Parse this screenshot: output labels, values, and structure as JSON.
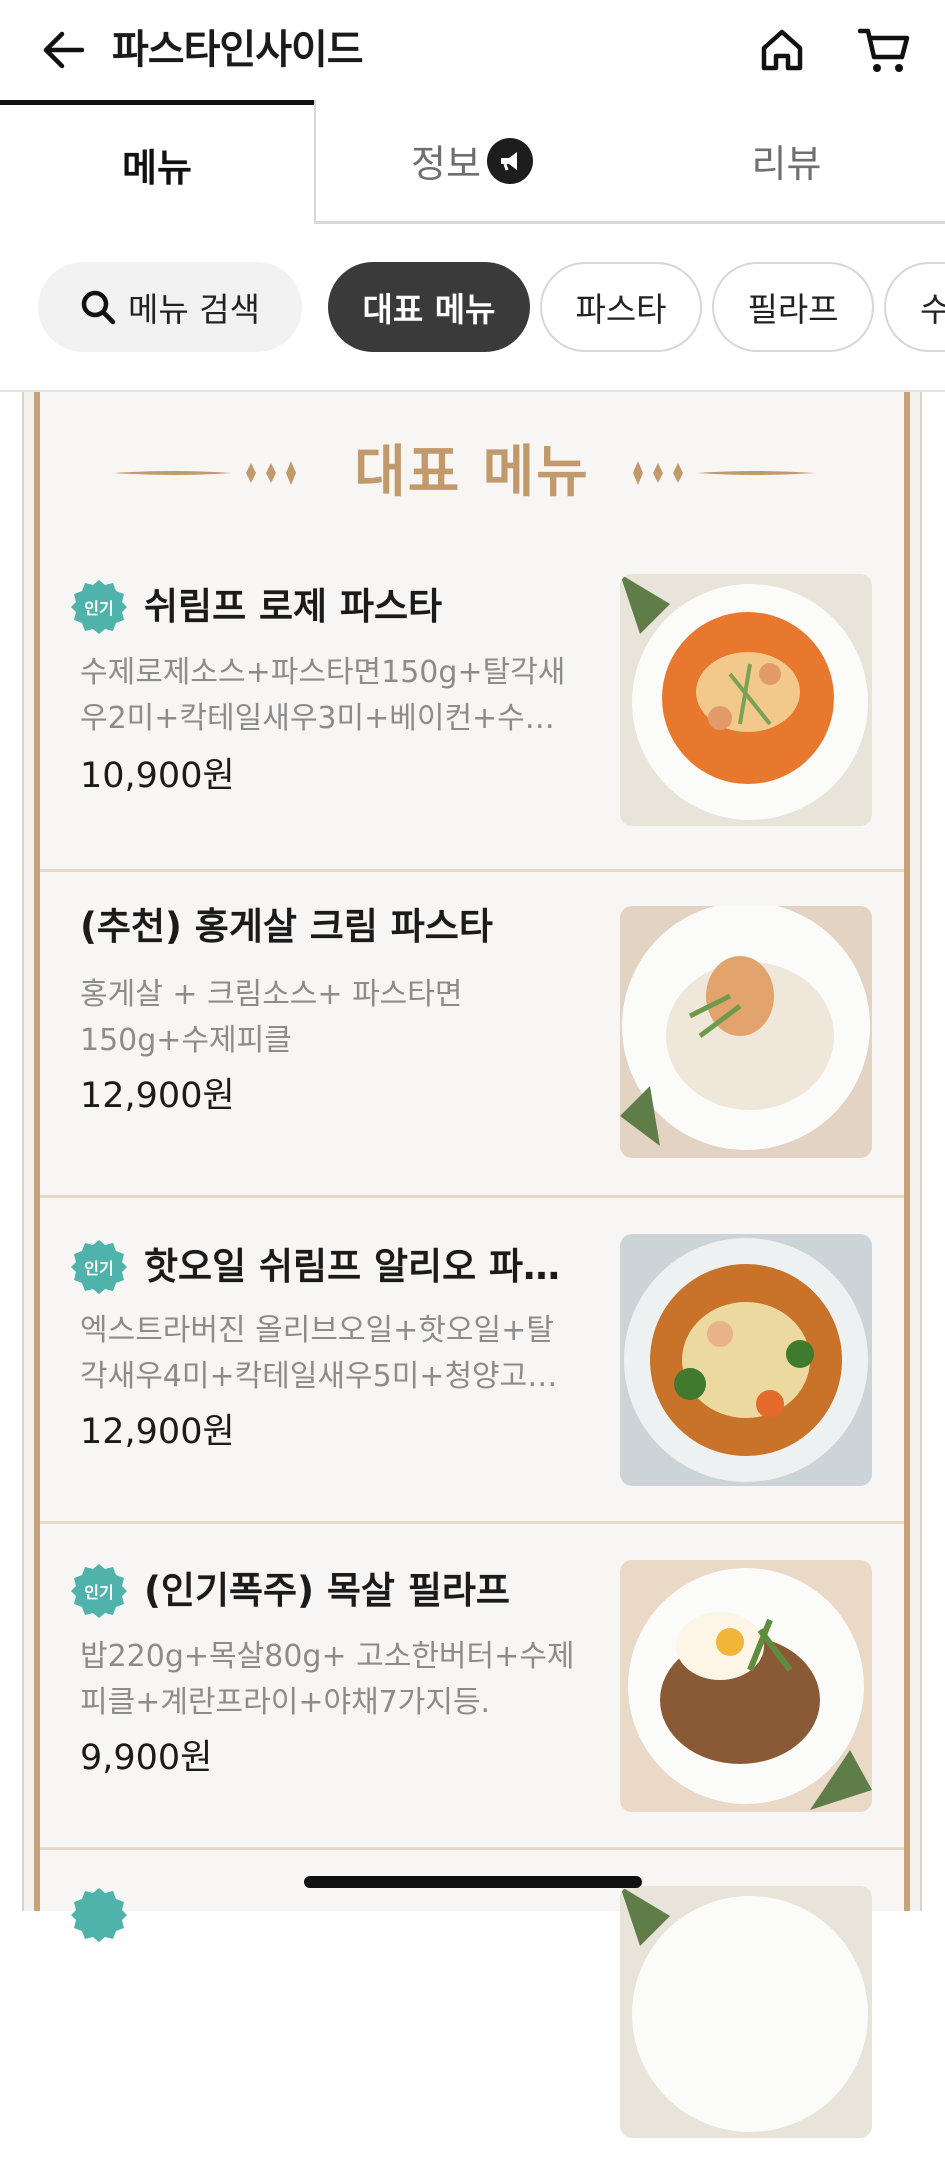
{
  "header": {
    "title": "파스타인사이드",
    "back_icon": "arrow-left-icon",
    "home_icon": "home-icon",
    "cart_icon": "cart-icon"
  },
  "tabs": [
    {
      "label": "메뉴",
      "active": true
    },
    {
      "label": "정보",
      "icon": "megaphone-icon"
    },
    {
      "label": "리뷰"
    }
  ],
  "chips": {
    "search_label": "메뉴 검색",
    "categories": [
      "대표 메뉴",
      "파스타",
      "필라프",
      "수"
    ]
  },
  "section": {
    "title": "대표 메뉴"
  },
  "items": [
    {
      "badge": "인기",
      "name": "쉬림프 로제 파스타",
      "description": "수제로제소스+파스타면150g+탈각새우2미+칵테일새우3미+베이컨+수…",
      "price": "10,900원"
    },
    {
      "badge": "",
      "name": "(추천) 홍게살 크림 파스타",
      "description": "홍게살 + 크림소스+ 파스타면150g+수제피클",
      "price": "12,900원"
    },
    {
      "badge": "인기",
      "name": "핫오일 쉬림프 알리오 파…",
      "description": "엑스트라버진 올리브오일+핫오일+탈각새우4미+칵테일새우5미+청양고…",
      "price": "12,900원"
    },
    {
      "badge": "인기",
      "name": "(인기폭주) 목살 필라프",
      "description": "밥220g+목살80g+ 고소한버터+수제피클+계란프라이+야채7가지등.",
      "price": "9,900원"
    }
  ],
  "colors": {
    "accent_gold": "#c19a6b",
    "badge_teal": "#4fb3ac",
    "chip_active": "#3a3a3a"
  }
}
